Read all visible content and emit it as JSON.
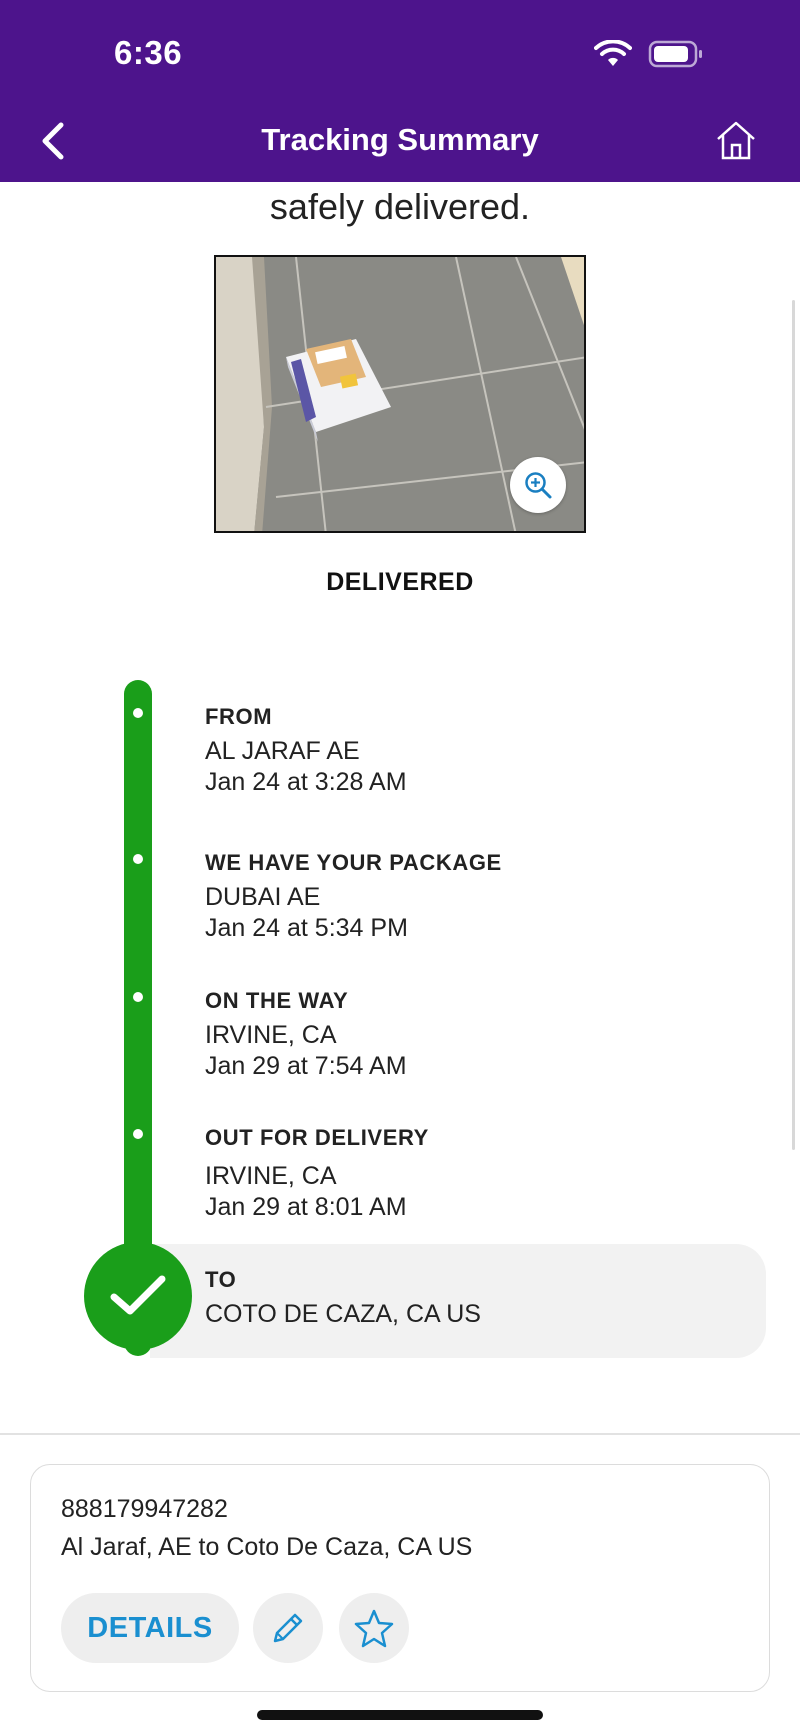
{
  "status_bar": {
    "time": "6:36"
  },
  "nav": {
    "title": "Tracking Summary"
  },
  "content": {
    "intro_text": "safely delivered.",
    "status": "DELIVERED"
  },
  "timeline": {
    "steps": [
      {
        "title": "FROM",
        "location": "AL JARAF AE",
        "time": "Jan 24 at 3:28 AM"
      },
      {
        "title": "WE HAVE YOUR PACKAGE",
        "location": "DUBAI AE",
        "time": "Jan 24 at 5:34 PM"
      },
      {
        "title": "ON THE WAY",
        "location": "IRVINE, CA",
        "time": "Jan 29 at 7:54 AM"
      },
      {
        "title": "OUT FOR DELIVERY",
        "location": "IRVINE, CA",
        "time": "Jan 29 at 8:01 AM"
      }
    ],
    "destination": {
      "title": "TO",
      "location": "COTO DE CAZA, CA  US"
    }
  },
  "card": {
    "tracking_number": "888179947282",
    "route": "Al Jaraf, AE to Coto De Caza, CA US",
    "details_label": "DETAILS"
  },
  "colors": {
    "header_purple": "#4d148c",
    "timeline_green": "#1a9e1a",
    "link_blue": "#1a8fd0"
  },
  "icons": [
    "back-chevron-icon",
    "home-icon",
    "wifi-icon",
    "battery-icon",
    "zoom-in-icon",
    "checkmark-icon",
    "pencil-icon",
    "star-icon"
  ]
}
